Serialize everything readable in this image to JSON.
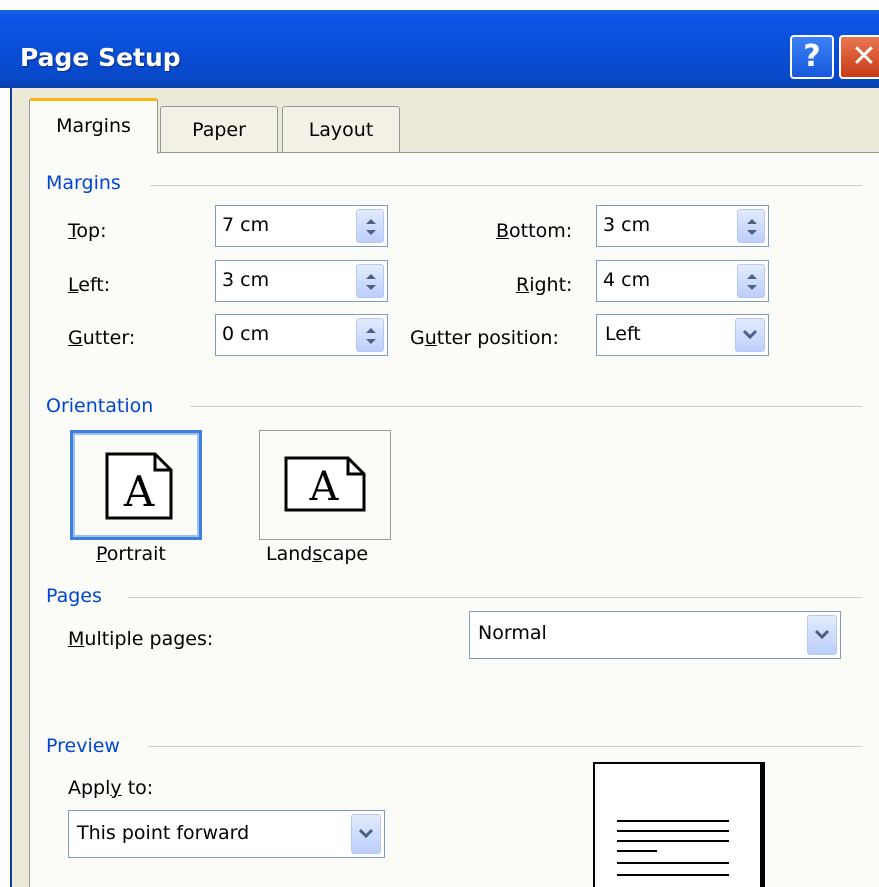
{
  "window": {
    "title": "Page Setup",
    "help_glyph": "?",
    "close_glyph": "✕"
  },
  "tabs": [
    {
      "label": "Margins",
      "active": true
    },
    {
      "label": "Paper",
      "active": false
    },
    {
      "label": "Layout",
      "active": false
    }
  ],
  "margins": {
    "section_title": "Margins",
    "top": {
      "label": "Top:",
      "value": "7 cm"
    },
    "bottom": {
      "label": "Bottom:",
      "value": "3 cm"
    },
    "left": {
      "label": "Left:",
      "value": "3 cm"
    },
    "right": {
      "label": "Right:",
      "value": "4 cm"
    },
    "gutter": {
      "label": "Gutter:",
      "value": "0 cm"
    },
    "gutter_position": {
      "label": "Gutter position:",
      "value": "Left"
    }
  },
  "orientation": {
    "section_title": "Orientation",
    "portrait_label": "Portrait",
    "landscape_label": "Landscape",
    "icon_letter": "A",
    "selected": "portrait"
  },
  "pages": {
    "section_title": "Pages",
    "multiple_pages_label": "Multiple pages:",
    "multiple_pages_value": "Normal"
  },
  "preview": {
    "section_title": "Preview",
    "apply_to_label": "Apply to:",
    "apply_to_value": "This point forward"
  },
  "colors": {
    "titlebar": "#0a4fd8",
    "group_title": "#0046d5",
    "dialog_bg": "#ece9d8",
    "selected_border": "#3c7fdc"
  }
}
